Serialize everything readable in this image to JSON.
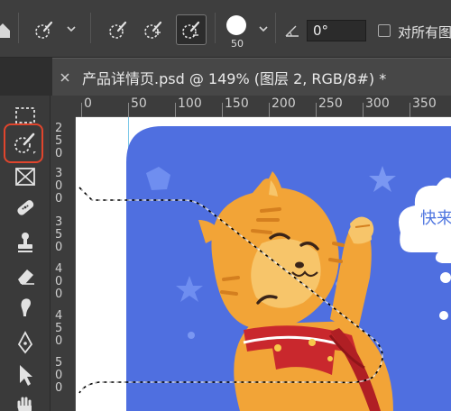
{
  "options_bar": {
    "brush_size": "50",
    "angle_value": "0°",
    "sample_all_layers_label": "对所有图",
    "icons": [
      "selection-brush-icon",
      "new-selection-brush-icon",
      "add-selection-brush-icon",
      "subtract-selection-brush-icon",
      "brush-size-preview",
      "angle-icon"
    ]
  },
  "document_tab": {
    "title": "产品详情页.psd @ 149% (图层 2, RGB/8#) *"
  },
  "ruler_top": {
    "labels": [
      "0",
      "50",
      "100",
      "150",
      "200",
      "250",
      "300",
      "350"
    ]
  },
  "ruler_left": {
    "groups": [
      [
        "2",
        "5",
        "0"
      ],
      [
        "3",
        "0",
        "0"
      ],
      [
        "3",
        "5",
        "0"
      ],
      [
        "4",
        "0",
        "0"
      ],
      [
        "4",
        "5",
        "0"
      ],
      [
        "5",
        "0",
        "0"
      ]
    ]
  },
  "toolbar": {
    "tools": [
      "marquee-tool",
      "quick-selection-tool",
      "frame-tool",
      "healing-brush-tool",
      "stamp-tool",
      "eraser-tool",
      "smudge-tool",
      "pen-tool",
      "path-selection-tool",
      "hand-tool"
    ],
    "active_tool": "quick-selection-tool"
  },
  "canvas": {
    "cloud_text": "快来"
  },
  "colors": {
    "accent_active": "#e0452d",
    "art_background": "#4f6fe0",
    "cat_orange": "#f2a437",
    "scarf_red": "#c9282d"
  }
}
